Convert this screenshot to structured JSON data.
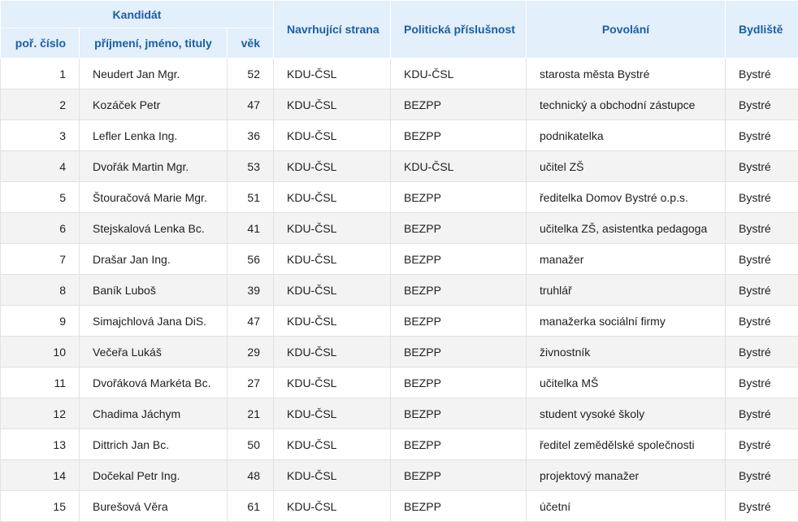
{
  "header": {
    "candidate_group": "Kandidát",
    "order_number": "poř. číslo",
    "name": "příjmení, jméno, tituly",
    "age": "věk",
    "nominating_party": "Navrhující strana",
    "political_affiliation": "Politická příslušnost",
    "occupation": "Povolání",
    "residence": "Bydliště"
  },
  "rows": [
    {
      "no": "1",
      "name": "Neudert Jan Mgr.",
      "age": "52",
      "party": "KDU-ČSL",
      "affiliation": "KDU-ČSL",
      "occupation": "starosta města Bystré",
      "residence": "Bystré"
    },
    {
      "no": "2",
      "name": "Kozáček Petr",
      "age": "47",
      "party": "KDU-ČSL",
      "affiliation": "BEZPP",
      "occupation": "technický a obchodní zástupce",
      "residence": "Bystré"
    },
    {
      "no": "3",
      "name": "Lefler Lenka Ing.",
      "age": "36",
      "party": "KDU-ČSL",
      "affiliation": "BEZPP",
      "occupation": "podnikatelka",
      "residence": "Bystré"
    },
    {
      "no": "4",
      "name": "Dvořák Martin Mgr.",
      "age": "53",
      "party": "KDU-ČSL",
      "affiliation": "KDU-ČSL",
      "occupation": "učitel ZŠ",
      "residence": "Bystré"
    },
    {
      "no": "5",
      "name": "Štouračová Marie Mgr.",
      "age": "51",
      "party": "KDU-ČSL",
      "affiliation": "BEZPP",
      "occupation": "ředitelka Domov Bystré o.p.s.",
      "residence": "Bystré"
    },
    {
      "no": "6",
      "name": "Stejskalová Lenka Bc.",
      "age": "41",
      "party": "KDU-ČSL",
      "affiliation": "BEZPP",
      "occupation": "učitelka ZŠ, asistentka pedagoga",
      "residence": "Bystré"
    },
    {
      "no": "7",
      "name": "Drašar Jan Ing.",
      "age": "56",
      "party": "KDU-ČSL",
      "affiliation": "BEZPP",
      "occupation": "manažer",
      "residence": "Bystré"
    },
    {
      "no": "8",
      "name": "Baník Luboš",
      "age": "39",
      "party": "KDU-ČSL",
      "affiliation": "BEZPP",
      "occupation": "truhlář",
      "residence": "Bystré"
    },
    {
      "no": "9",
      "name": "Simajchlová Jana DiS.",
      "age": "47",
      "party": "KDU-ČSL",
      "affiliation": "BEZPP",
      "occupation": "manažerka sociální firmy",
      "residence": "Bystré"
    },
    {
      "no": "10",
      "name": "Večeřa Lukáš",
      "age": "29",
      "party": "KDU-ČSL",
      "affiliation": "BEZPP",
      "occupation": "živnostník",
      "residence": "Bystré"
    },
    {
      "no": "11",
      "name": "Dvořáková Markéta Bc.",
      "age": "27",
      "party": "KDU-ČSL",
      "affiliation": "BEZPP",
      "occupation": "učitelka MŠ",
      "residence": "Bystré"
    },
    {
      "no": "12",
      "name": "Chadima Jáchym",
      "age": "21",
      "party": "KDU-ČSL",
      "affiliation": "BEZPP",
      "occupation": "student vysoké školy",
      "residence": "Bystré"
    },
    {
      "no": "13",
      "name": "Dittrich Jan Bc.",
      "age": "50",
      "party": "KDU-ČSL",
      "affiliation": "BEZPP",
      "occupation": "ředitel zemědělské společnosti",
      "residence": "Bystré"
    },
    {
      "no": "14",
      "name": "Dočekal Petr Ing.",
      "age": "48",
      "party": "KDU-ČSL",
      "affiliation": "BEZPP",
      "occupation": "projektový manažer",
      "residence": "Bystré"
    },
    {
      "no": "15",
      "name": "Burešová Věra",
      "age": "61",
      "party": "KDU-ČSL",
      "affiliation": "BEZPP",
      "occupation": "účetní",
      "residence": "Bystré"
    }
  ]
}
